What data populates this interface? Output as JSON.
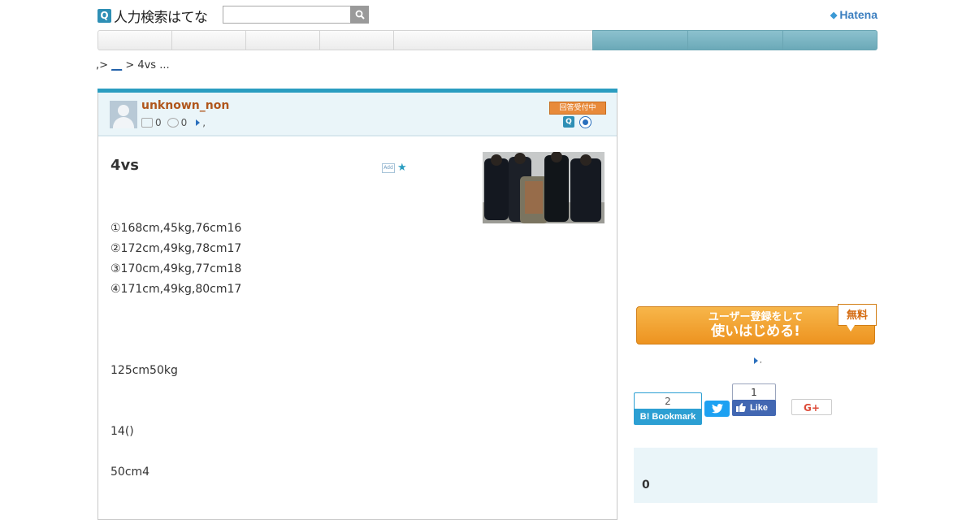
{
  "header": {
    "logo_mark": "Q",
    "logo_text": "人力検索はてな",
    "search_placeholder": "",
    "brand": "Hatena"
  },
  "nav": {
    "items": [
      "",
      "",
      "",
      "",
      ""
    ],
    "blue_items": [
      "",
      "",
      ""
    ]
  },
  "breadcrumb": {
    "prefix": ",>",
    "link": "__",
    "rest": "> 4vs ..."
  },
  "question": {
    "username": "unknown_non",
    "answers_count": "0",
    "points_count": "0",
    "stats_suffix": ",",
    "status_badge": "回答受付中",
    "title": "4vs",
    "lines": [
      "①168cm,45kg,76cm16",
      "②172cm,49kg,78cm17",
      "③170cm,49kg,77cm18",
      "④171cm,49kg,80cm17",
      "125cm50kg",
      "14()",
      "50cm4"
    ]
  },
  "sidebar": {
    "signup_line1": "ユーザー登録をして",
    "signup_line2": "使いはじめる!",
    "free_badge": "無料",
    "link_suffix": ",",
    "bookmark_count": "2",
    "bookmark_label": "B! Bookmark",
    "tweet_label": "t",
    "like_count": "1",
    "like_label": "Like",
    "gplus_label": "G+",
    "box_value": "0"
  },
  "colors": {
    "accent": "#2a9dc0",
    "nav_blue": "#7fb7c5",
    "username": "#b0561b",
    "signup": "#ed9320"
  }
}
